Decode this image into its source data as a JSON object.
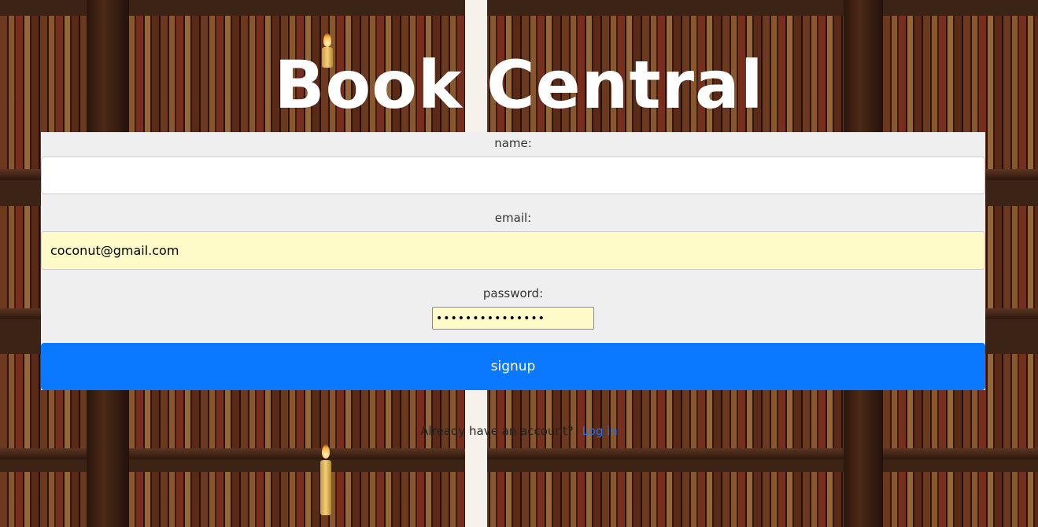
{
  "header": {
    "title": "Book Central"
  },
  "form": {
    "name_label": "name:",
    "name_value": "",
    "email_label": "email:",
    "email_value": "coconut@gmail.com",
    "password_label": "password:",
    "password_value": "•••••••••••••••",
    "signup_label": "signup"
  },
  "footer": {
    "prompt_text": "Already have an account?",
    "login_link": "Log in"
  },
  "colors": {
    "signup_button": "#0a78ff",
    "autofill_background": "#fffbc8",
    "form_background": "#efefef",
    "link": "#1a73ff"
  },
  "icons": {
    "background_image": "library-bookshelf-background"
  }
}
